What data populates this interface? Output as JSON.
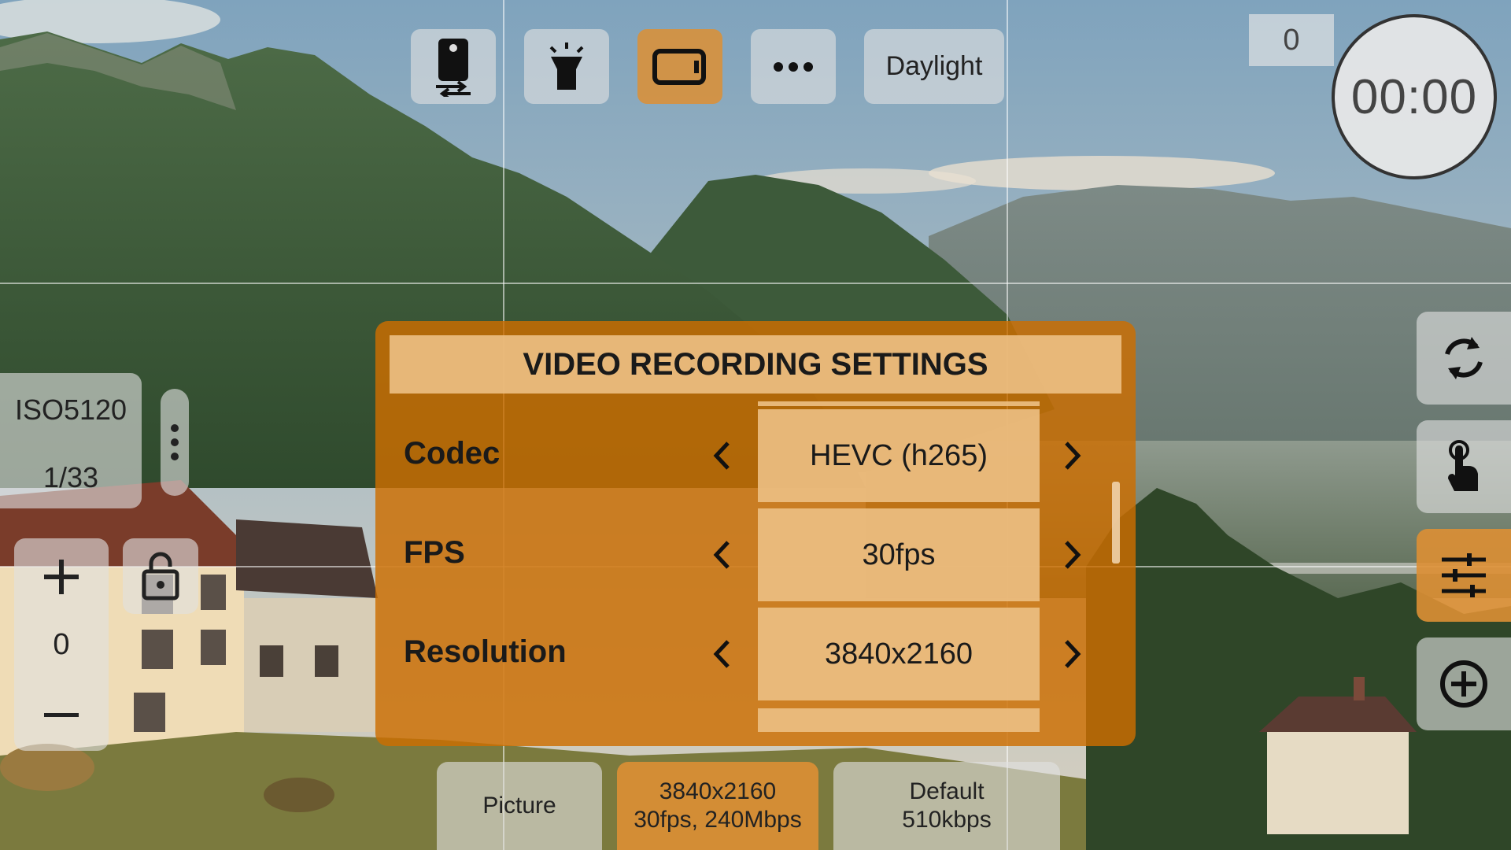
{
  "toolbar": {
    "buttons": [
      {
        "name": "camera-switch",
        "icon": "phone-camera-switch-icon"
      },
      {
        "name": "flashlight",
        "icon": "flashlight-icon"
      },
      {
        "name": "video-mode",
        "icon": "video-frame-icon",
        "active": true
      },
      {
        "name": "more",
        "icon": "more-dots-icon"
      }
    ],
    "white_balance_label": "Daylight"
  },
  "recording": {
    "counter": "0",
    "timer": "00:00"
  },
  "exposure": {
    "iso": "ISO5120",
    "shutter": "1/33",
    "ev_value": "0",
    "ev_plus_icon": "plus-icon",
    "ev_minus_icon": "minus-icon",
    "lock_icon": "unlock-icon",
    "menu_icon": "vertical-dots-icon"
  },
  "side_buttons": [
    {
      "name": "rotate",
      "icon": "rotate-arrows-icon"
    },
    {
      "name": "touch",
      "icon": "touch-hand-icon"
    },
    {
      "name": "settings",
      "icon": "sliders-icon",
      "active": true
    },
    {
      "name": "add",
      "icon": "plus-circle-icon"
    }
  ],
  "settings_panel": {
    "title": "VIDEO RECORDING SETTINGS",
    "rows": [
      {
        "label": "Codec",
        "value": "HEVC (h265)"
      },
      {
        "label": "FPS",
        "value": "30fps"
      },
      {
        "label": "Resolution",
        "value": "3840x2160"
      }
    ]
  },
  "mode_tabs": [
    {
      "line1": "Picture",
      "line2": ""
    },
    {
      "line1": "3840x2160",
      "line2": "30fps, 240Mbps",
      "active": true
    },
    {
      "line1": "Default",
      "line2": "510kbps"
    }
  ],
  "colors": {
    "accent": "#DD8F34",
    "panel": "#CD6E00",
    "panel_highlight": "#ECBE82"
  }
}
